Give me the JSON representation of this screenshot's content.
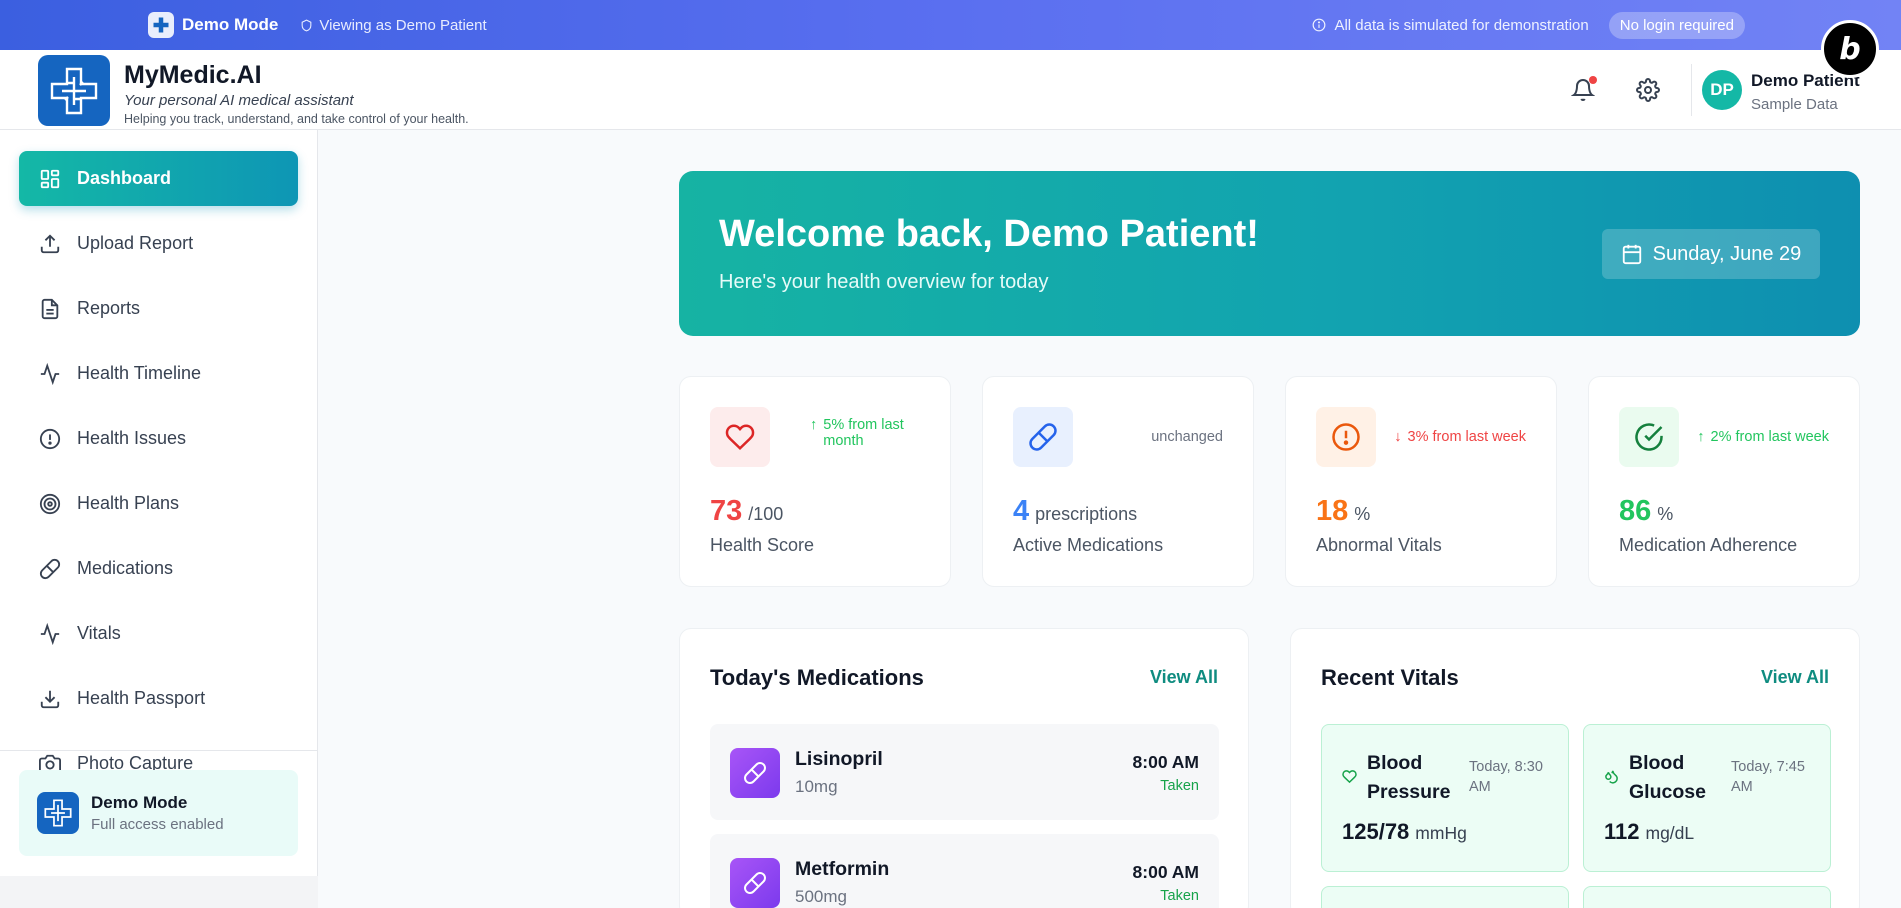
{
  "banner": {
    "mode_label": "Demo Mode",
    "viewing_label": "Viewing as Demo Patient",
    "note": "All data is simulated for demonstration",
    "pill": "No login required"
  },
  "header": {
    "brand_title": "MyMedic.AI",
    "tagline": "Your personal AI medical assistant",
    "subtitle": "Helping you track, understand, and take control of your health.",
    "user_initials": "DP",
    "user_name": "Demo Patient",
    "user_sub": "Sample Data",
    "has_notification": true
  },
  "sidebar": {
    "items": [
      {
        "label": "Dashboard",
        "icon": "grid-icon",
        "active": true
      },
      {
        "label": "Upload Report",
        "icon": "upload-icon"
      },
      {
        "label": "Reports",
        "icon": "document-icon"
      },
      {
        "label": "Health Timeline",
        "icon": "activity-icon"
      },
      {
        "label": "Health Issues",
        "icon": "alert-circle-icon"
      },
      {
        "label": "Health Plans",
        "icon": "target-icon"
      },
      {
        "label": "Medications",
        "icon": "pill-icon"
      },
      {
        "label": "Vitals",
        "icon": "activity-icon"
      },
      {
        "label": "Health Passport",
        "icon": "download-icon"
      },
      {
        "label": "Photo Capture",
        "icon": "camera-icon"
      }
    ],
    "demo_card": {
      "title": "Demo Mode",
      "subtitle": "Full access enabled"
    }
  },
  "welcome": {
    "title": "Welcome back, Demo Patient!",
    "subtitle": "Here's your health overview for today",
    "date": "Sunday, June 29"
  },
  "stats": [
    {
      "value": "73",
      "unit": "/100",
      "label": "Health Score",
      "trend": "5% from last month",
      "trend_dir": "up",
      "color": "#ef4444",
      "icon": "heart-icon"
    },
    {
      "value": "4",
      "unit": "prescriptions",
      "label": "Active Medications",
      "trend": "unchanged",
      "trend_dir": "none",
      "color": "#3b82f6",
      "icon": "pill-icon"
    },
    {
      "value": "18",
      "unit": "%",
      "label": "Abnormal Vitals",
      "trend": "3% from last week",
      "trend_dir": "down",
      "color": "#f97316",
      "icon": "alert-circle-icon"
    },
    {
      "value": "86",
      "unit": "%",
      "label": "Medication Adherence",
      "trend": "2% from last week",
      "trend_dir": "up",
      "color": "#22c55e",
      "icon": "check-circle-icon"
    }
  ],
  "medications": {
    "title": "Today's Medications",
    "view_all": "View All",
    "items": [
      {
        "name": "Lisinopril",
        "dose": "10mg",
        "time": "8:00 AM",
        "status": "Taken"
      },
      {
        "name": "Metformin",
        "dose": "500mg",
        "time": "8:00 AM",
        "status": "Taken"
      }
    ]
  },
  "vitals": {
    "title": "Recent Vitals",
    "view_all": "View All",
    "items": [
      {
        "name": "Blood Pressure",
        "time": "Today, 8:30 AM",
        "value": "125/78",
        "unit": "mmHg",
        "icon": "heart-icon"
      },
      {
        "name": "Blood Glucose",
        "time": "Today, 7:45 AM",
        "value": "112",
        "unit": "mg/dL",
        "icon": "droplets-icon"
      }
    ]
  }
}
